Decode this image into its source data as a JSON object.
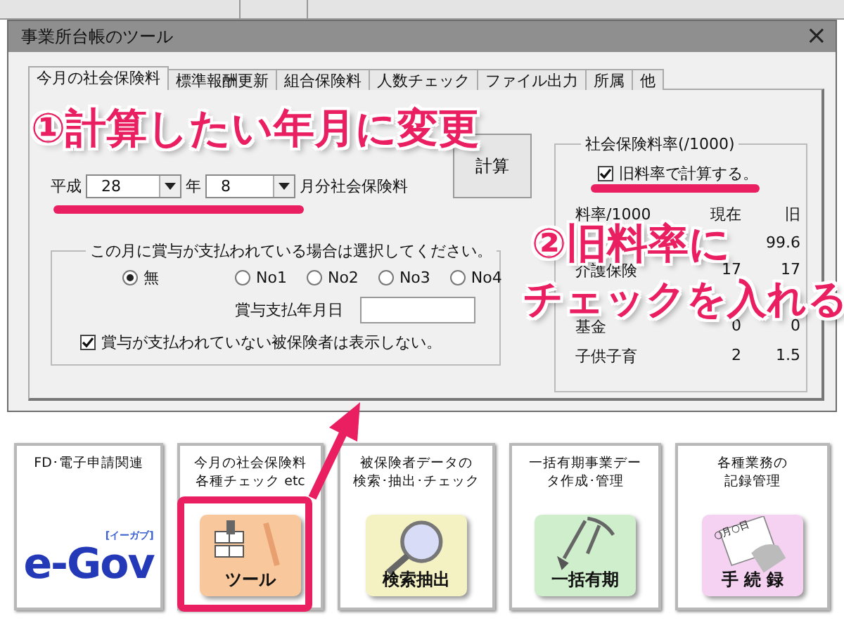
{
  "window": {
    "title": "事業所台帳のツール",
    "close": "×"
  },
  "tabs": [
    {
      "label": "今月の社会保険料",
      "selected": true
    },
    {
      "label": "標準報酬更新",
      "selected": false
    },
    {
      "label": "組合保険料",
      "selected": false
    },
    {
      "label": "人数チェック",
      "selected": false
    },
    {
      "label": "ファイル出力",
      "selected": false
    },
    {
      "label": "所属",
      "selected": false
    },
    {
      "label": "他",
      "selected": false
    }
  ],
  "period": {
    "era": "平成",
    "year": "28",
    "year_unit": "年",
    "month": "8",
    "suffix": "月分社会保険料",
    "calc_button": "計算"
  },
  "bonus_group": {
    "legend": "この月に賞与が支払われている場合は選択してください。",
    "options": [
      {
        "label": "無",
        "selected": true
      },
      {
        "label": "No1",
        "selected": false
      },
      {
        "label": "No2",
        "selected": false
      },
      {
        "label": "No3",
        "selected": false
      },
      {
        "label": "No4",
        "selected": false
      }
    ],
    "date_label": "賞与支払年月日",
    "hide_checkbox": {
      "label": "賞与が支払われていない被保険者は表示しない。",
      "checked": true
    }
  },
  "rate_group": {
    "legend": "社会保険料率(/1000)",
    "old_rate_checkbox": {
      "label": "旧料率で計算する。",
      "checked": true
    },
    "header": [
      "料率/1000",
      "現在",
      "旧"
    ],
    "rows": [
      {
        "old": "99.6"
      },
      {
        "name": "介護保険",
        "current": "17",
        "old": "17"
      },
      {},
      {
        "name": "基金",
        "current": "0",
        "old": "0"
      },
      {
        "name": "子供子育",
        "current": "2",
        "old": "1.5"
      }
    ]
  },
  "tiles": [
    {
      "kind": "egov",
      "title": [
        "FD･電子申請関連"
      ],
      "logo": "e-Gov",
      "logo_note": "[イーガブ]",
      "highlighted": false
    },
    {
      "kind": "tool",
      "title": [
        "今月の社会保険料",
        "各種チェック etc"
      ],
      "label": "ツール",
      "color": "#f8c89c",
      "highlighted": true
    },
    {
      "kind": "search",
      "title": [
        "被保険者データの",
        "検索･抽出･チェック"
      ],
      "label": "検索抽出",
      "color": "#f4f2c2",
      "highlighted": false
    },
    {
      "kind": "dig",
      "title": [
        "一括有期事業デー",
        "タ作成･管理"
      ],
      "label": "一括有期",
      "color": "#cfeecb",
      "highlighted": false
    },
    {
      "kind": "record",
      "title": [
        "各種業務の",
        "記録管理"
      ],
      "label": "手 続 録",
      "card_text": "○月○日",
      "color": "#f6d2f2",
      "highlighted": false
    }
  ],
  "annotations": [
    {
      "kind": "step",
      "text": "①計算したい年月に変更"
    },
    {
      "kind": "step",
      "text": "②旧料率に",
      "line2": "チェックを入れる"
    }
  ]
}
